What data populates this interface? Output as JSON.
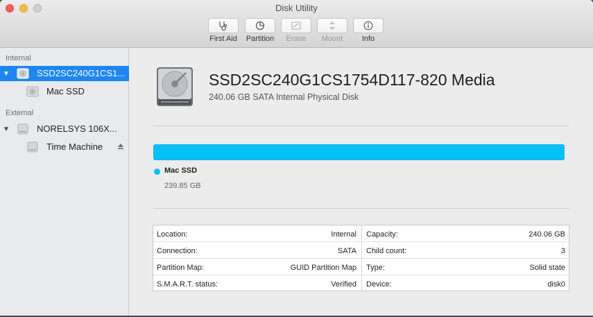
{
  "window": {
    "title": "Disk Utility"
  },
  "toolbar": [
    {
      "label": "First Aid",
      "icon": "stethoscope-icon",
      "enabled": true
    },
    {
      "label": "Partition",
      "icon": "pie-icon",
      "enabled": true
    },
    {
      "label": "Erase",
      "icon": "erase-icon",
      "enabled": false
    },
    {
      "label": "Mount",
      "icon": "mount-icon",
      "enabled": false
    },
    {
      "label": "Info",
      "icon": "info-icon",
      "enabled": true
    }
  ],
  "sidebar": {
    "internal_header": "Internal",
    "external_header": "External",
    "internal_disk": "SSD2SC240G1CS1...",
    "internal_volume": "Mac SSD",
    "external_disk": "NORELSYS 106X...",
    "external_volume": "Time Machine"
  },
  "disk": {
    "name": "SSD2SC240G1CS1754D117-820 Media",
    "subtitle": "240.06 GB SATA Internal Physical Disk"
  },
  "usage": {
    "color": "#00c2f2",
    "partition_name": "Mac SSD",
    "partition_size": "239.85 GB",
    "fraction": 0.999
  },
  "info": {
    "left": [
      {
        "key": "Location:",
        "value": "Internal"
      },
      {
        "key": "Connection:",
        "value": "SATA"
      },
      {
        "key": "Partition Map:",
        "value": "GUID Partition Map"
      },
      {
        "key": "S.M.A.R.T. status:",
        "value": "Verified"
      }
    ],
    "right": [
      {
        "key": "Capacity:",
        "value": "240.06 GB"
      },
      {
        "key": "Child count:",
        "value": "3"
      },
      {
        "key": "Type:",
        "value": "Solid state"
      },
      {
        "key": "Device:",
        "value": "disk0"
      }
    ]
  }
}
